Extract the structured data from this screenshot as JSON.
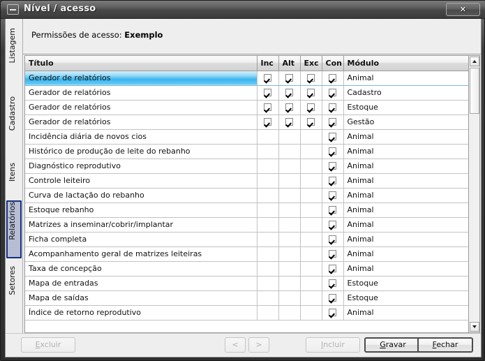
{
  "window": {
    "title": "Nível / acesso",
    "icon": "minimize-box-icon",
    "close_label": "✕"
  },
  "header": {
    "prefix": "Permissões de acesso:",
    "value": "Exemplo"
  },
  "sidebar": {
    "tabs": [
      {
        "label": "Listagem",
        "selected": false
      },
      {
        "label": "Cadastro",
        "selected": false
      },
      {
        "label": "Itens",
        "selected": false
      },
      {
        "label": "Relatórios",
        "selected": true
      },
      {
        "label": "Setores",
        "selected": false
      }
    ]
  },
  "grid": {
    "columns": [
      "Título",
      "Inc",
      "Alt",
      "Exc",
      "Con",
      "Módulo"
    ],
    "rows": [
      {
        "titulo": "Gerador de relatórios",
        "inc": true,
        "alt": true,
        "exc": true,
        "con": true,
        "modulo": "Animal",
        "selected": true
      },
      {
        "titulo": "Gerador de relatórios",
        "inc": true,
        "alt": true,
        "exc": true,
        "con": true,
        "modulo": "Cadastro",
        "selected": false
      },
      {
        "titulo": "Gerador de relatórios",
        "inc": true,
        "alt": true,
        "exc": true,
        "con": true,
        "modulo": "Estoque",
        "selected": false
      },
      {
        "titulo": "Gerador de relatórios",
        "inc": true,
        "alt": true,
        "exc": true,
        "con": true,
        "modulo": "Gestão",
        "selected": false
      },
      {
        "titulo": "Incidência diária de novos cios",
        "inc": false,
        "alt": false,
        "exc": false,
        "con": true,
        "modulo": "Animal",
        "selected": false
      },
      {
        "titulo": "Histórico de produção de leite do rebanho",
        "inc": false,
        "alt": false,
        "exc": false,
        "con": true,
        "modulo": "Animal",
        "selected": false
      },
      {
        "titulo": "Diagnóstico reprodutivo",
        "inc": false,
        "alt": false,
        "exc": false,
        "con": true,
        "modulo": "Animal",
        "selected": false
      },
      {
        "titulo": "Controle leiteiro",
        "inc": false,
        "alt": false,
        "exc": false,
        "con": true,
        "modulo": "Animal",
        "selected": false
      },
      {
        "titulo": "Curva de lactação do rebanho",
        "inc": false,
        "alt": false,
        "exc": false,
        "con": true,
        "modulo": "Animal",
        "selected": false
      },
      {
        "titulo": "Estoque rebanho",
        "inc": false,
        "alt": false,
        "exc": false,
        "con": true,
        "modulo": "Animal",
        "selected": false
      },
      {
        "titulo": "Matrizes a inseminar/cobrir/implantar",
        "inc": false,
        "alt": false,
        "exc": false,
        "con": true,
        "modulo": "Animal",
        "selected": false
      },
      {
        "titulo": "Ficha completa",
        "inc": false,
        "alt": false,
        "exc": false,
        "con": true,
        "modulo": "Animal",
        "selected": false
      },
      {
        "titulo": "Acompanhamento geral de matrizes leiteiras",
        "inc": false,
        "alt": false,
        "exc": false,
        "con": true,
        "modulo": "Animal",
        "selected": false
      },
      {
        "titulo": "Taxa de concepção",
        "inc": false,
        "alt": false,
        "exc": false,
        "con": true,
        "modulo": "Animal",
        "selected": false
      },
      {
        "titulo": "Mapa de entradas",
        "inc": false,
        "alt": false,
        "exc": false,
        "con": true,
        "modulo": "Estoque",
        "selected": false
      },
      {
        "titulo": "Mapa de saídas",
        "inc": false,
        "alt": false,
        "exc": false,
        "con": true,
        "modulo": "Estoque",
        "selected": false
      },
      {
        "titulo": "Índice de retorno reprodutivo",
        "inc": false,
        "alt": false,
        "exc": false,
        "con": true,
        "modulo": "Animal",
        "selected": false
      }
    ]
  },
  "scrollbar": {
    "up_icon": "triangle-up-icon",
    "down_icon": "triangle-down-icon"
  },
  "buttons": {
    "excluir": {
      "label": "Excluir",
      "mnemonic": "E",
      "disabled": true
    },
    "previous": {
      "label": "<",
      "disabled": true
    },
    "next": {
      "label": ">",
      "disabled": true
    },
    "incluir": {
      "label": "Incluir",
      "mnemonic": "I",
      "disabled": true
    },
    "gravar": {
      "label": "Gravar",
      "mnemonic": "G",
      "disabled": false
    },
    "fechar": {
      "label": "Fechar",
      "mnemonic": "F",
      "disabled": false
    }
  },
  "colors": {
    "selection": "#38b5ef",
    "tab_selected_border": "#14307d",
    "tab_selected_fill": "#b7bed4",
    "client_bg": "#eeeeee"
  }
}
